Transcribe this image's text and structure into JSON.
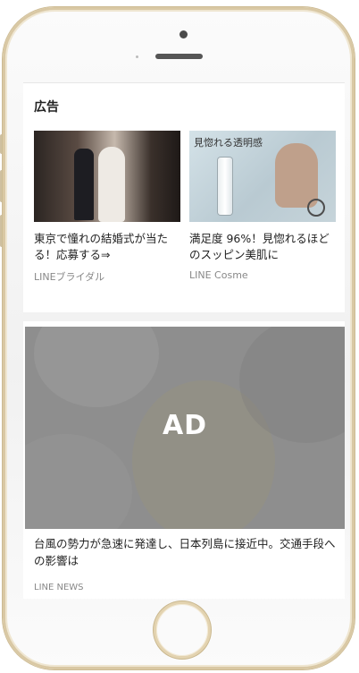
{
  "section_title": "広告",
  "cards": [
    {
      "title": "東京で憧れの結婚式が当たる！応募する⇒",
      "source": "LINEブライダル"
    },
    {
      "image_caption": "見惚れる透明感",
      "title": "満足度 96%！見惚れるほどのスッピン美肌に",
      "source": "LINE Cosme"
    }
  ],
  "main_ad": {
    "label": "AD"
  },
  "news": {
    "title": "台風の勢力が急速に発達し、日本列島に接近中。交通手段への影響は",
    "source": "LINE NEWS"
  },
  "colors": {
    "frame_gold": "#d9c8a4",
    "ad_overlay": "#8e8e8e"
  }
}
